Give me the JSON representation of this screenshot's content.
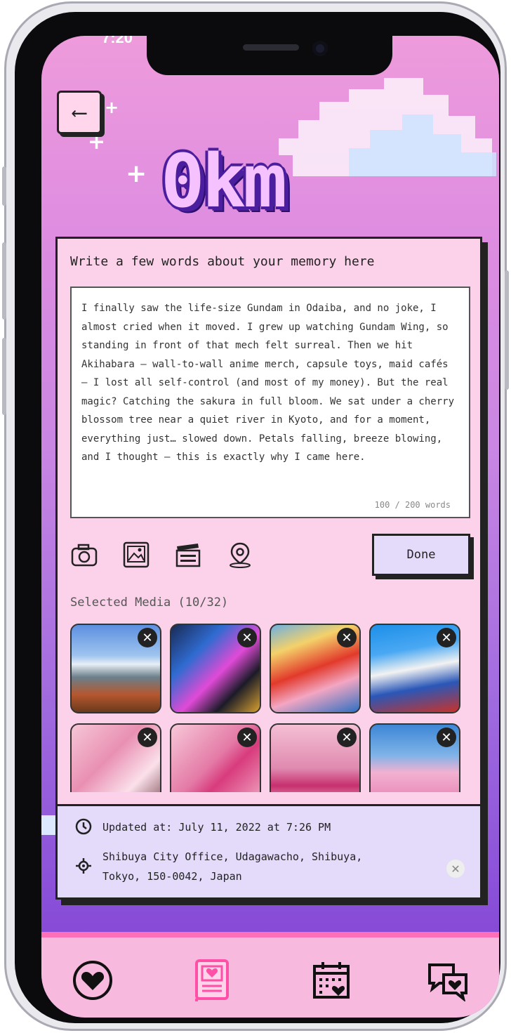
{
  "status": {
    "time": "7:20"
  },
  "header": {
    "back_label": "⟵",
    "title": "0km"
  },
  "editor": {
    "prompt": "Write a few words about your memory here",
    "text": "I finally saw the life-size Gundam in Odaiba, and no joke, I almost cried when it moved. I grew up watching Gundam Wing, so standing in front of that mech felt surreal. Then we hit Akihabara – wall-to-wall anime merch, capsule toys, maid cafés – I lost all self-control (and most of my money). But the real magic? Catching the sakura in full bloom. We sat under a cherry blossom tree near a quiet river in Kyoto, and for a moment, everything just… slowed down. Petals falling, breeze blowing, and I thought – this is exactly why I came here.",
    "word_count": "100 / 200 words"
  },
  "toolbar": {
    "icons": [
      "camera-icon",
      "image-icon",
      "video-icon",
      "location-pin-icon"
    ],
    "done_label": "Done"
  },
  "media": {
    "title": "Selected Media (10/32)",
    "close_glyph": "✕",
    "items": [
      {
        "name": "mount-fuji-pagoda"
      },
      {
        "name": "neon-street"
      },
      {
        "name": "one-piece-mural"
      },
      {
        "name": "gundam-statue"
      },
      {
        "name": "cherry-blossoms"
      },
      {
        "name": "sakura-person"
      },
      {
        "name": "kimono-umbrella"
      },
      {
        "name": "pink-pokemon-balloon"
      }
    ]
  },
  "info": {
    "updated": "Updated at: July 11, 2022 at 7:26 PM",
    "location_line1": "Shibuya City Office, Udagawacho, Shibuya,",
    "location_line2": "Tokyo, 150-0042, Japan",
    "close_glyph": "✕"
  },
  "nav": {
    "items": [
      "heart-icon",
      "journal-icon",
      "calendar-icon",
      "chat-icon"
    ],
    "active": "journal-icon",
    "colors": {
      "active": "#ff4fa6",
      "inactive": "#111111"
    }
  }
}
